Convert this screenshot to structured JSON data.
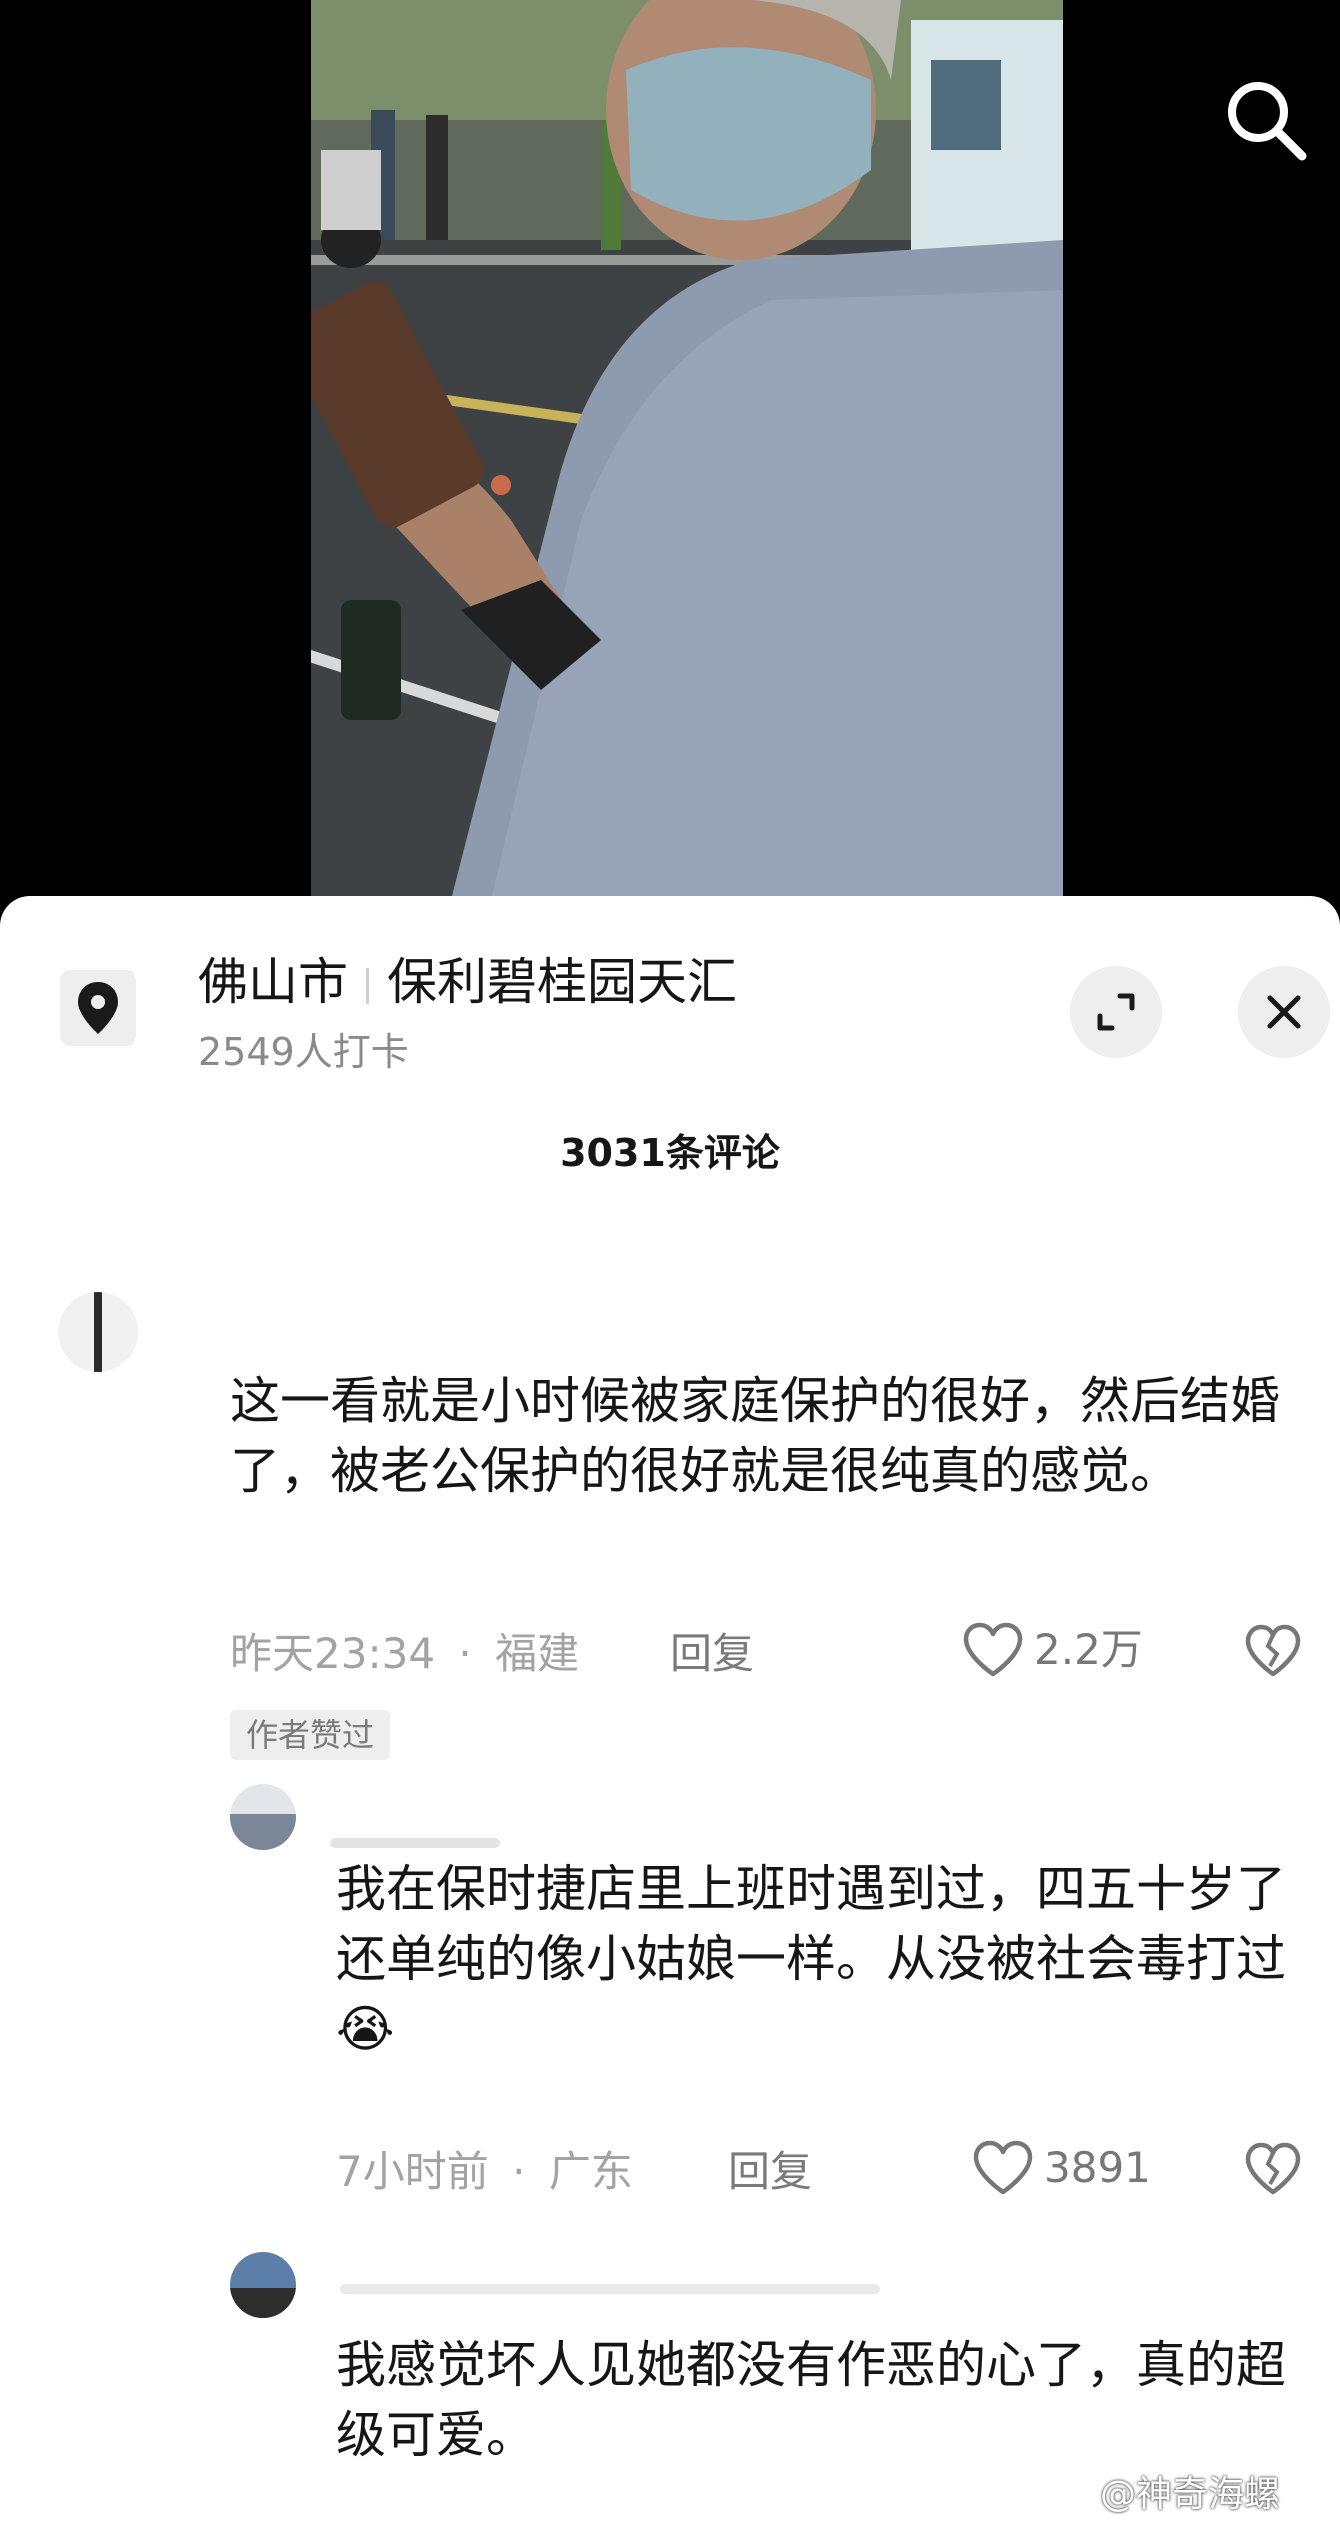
{
  "location": {
    "city": "佛山市",
    "place": "保利碧桂园天汇",
    "checkins": "2549人打卡"
  },
  "comment_count": "3031条评论",
  "comments": [
    {
      "text": "这一看就是小时候被家庭保护的很好，然后结婚了，被老公保护的很好就是很纯真的感觉。",
      "time": "昨天23:34",
      "region": "福建",
      "reply_label": "回复",
      "likes": "2.2万",
      "badge": "作者赞过"
    },
    {
      "text": "我在保时捷店里上班时遇到过，四五十岁了还单纯的像小姑娘一样。从没被社会毒打过😭",
      "time": "7小时前",
      "region": "广东",
      "reply_label": "回复",
      "likes": "3891"
    },
    {
      "text": "我感觉坏人见她都没有作恶的心了，真的超级可爱。"
    }
  ],
  "meta_separator": "·",
  "watermark": "@神奇海螺",
  "colors": {
    "sheet_background": "#ffffff",
    "primary_text": "#161616",
    "secondary_text": "#a3a3a3",
    "badge_background": "#eeeeee"
  },
  "icons": [
    "search-icon",
    "location-pin-icon",
    "expand-icon",
    "close-icon",
    "heart-icon",
    "broken-heart-icon"
  ]
}
